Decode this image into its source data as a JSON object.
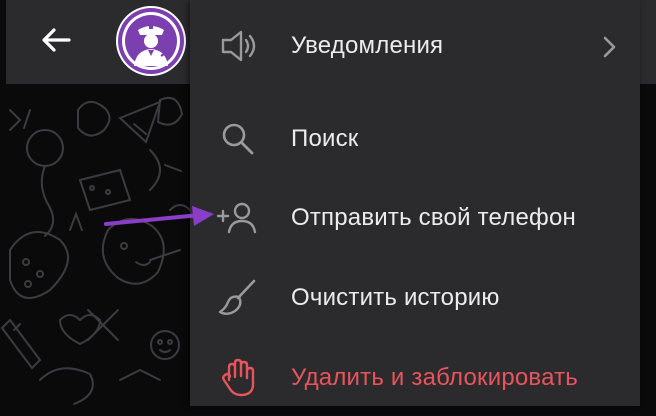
{
  "header": {
    "back_icon": "arrow-left-icon",
    "avatar_icon": "police-officer-avatar"
  },
  "menu": {
    "items": [
      {
        "label": "Уведомления",
        "icon": "speaker-icon",
        "has_submenu": true
      },
      {
        "label": "Поиск",
        "icon": "search-icon"
      },
      {
        "label": "Отправить свой телефон",
        "icon": "add-contact-icon"
      },
      {
        "label": "Очистить историю",
        "icon": "broom-icon"
      },
      {
        "label": "Удалить и заблокировать",
        "icon": "hand-stop-icon"
      }
    ]
  },
  "colors": {
    "panel": "#2b2b2e",
    "text": "#ececec",
    "icon": "#9a9a9e",
    "danger": "#e8545c",
    "avatar_accent": "#7b3fb0",
    "annotation_arrow": "#8a3ec8"
  }
}
